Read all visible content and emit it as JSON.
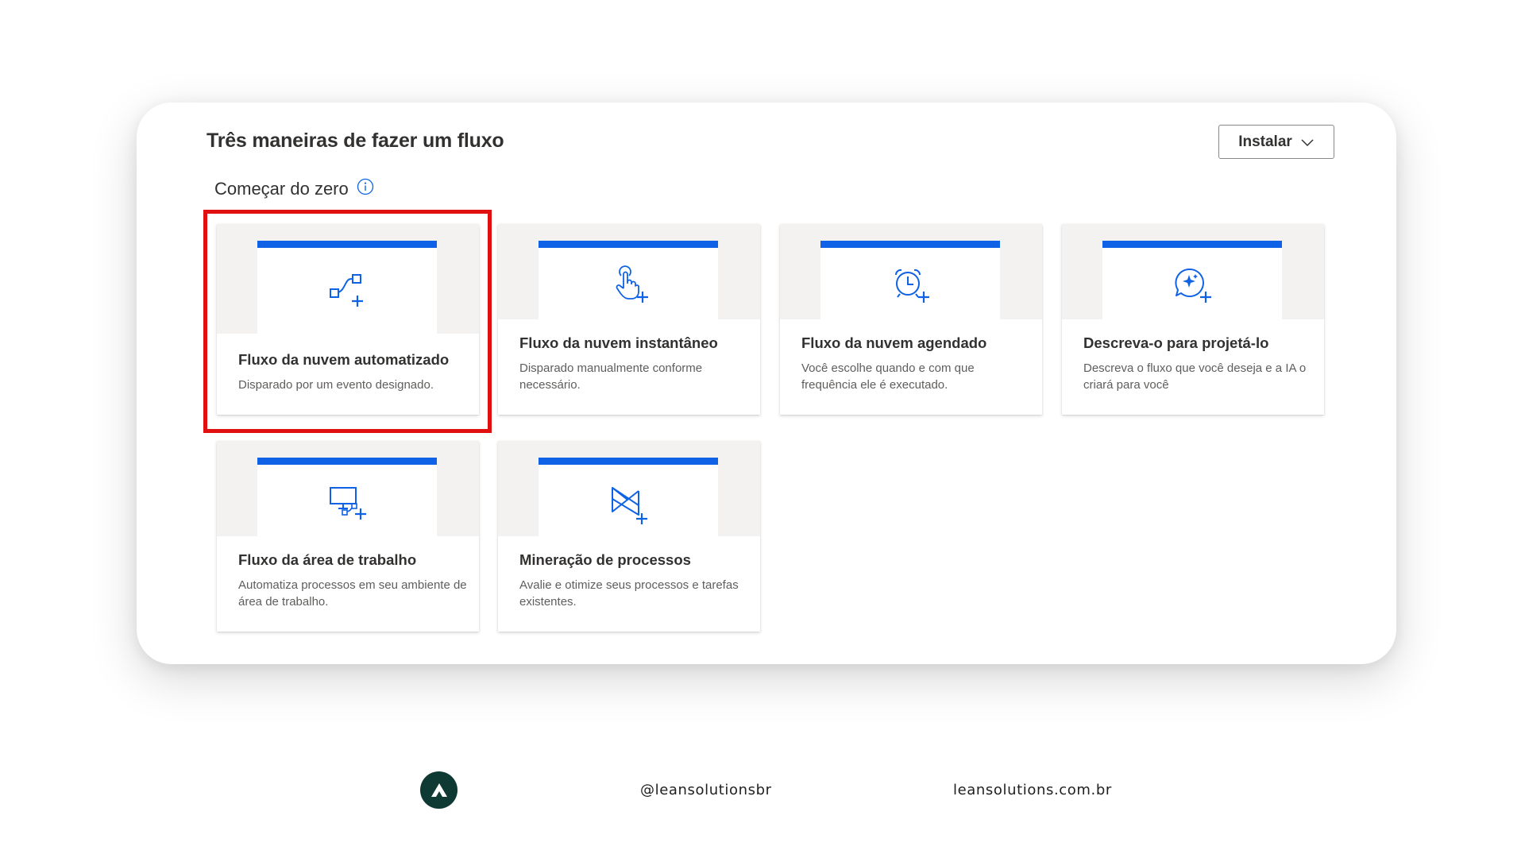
{
  "header": {
    "title": "Três maneiras de fazer um fluxo",
    "install_label": "Instalar"
  },
  "section": {
    "heading": "Começar do zero"
  },
  "tiles": [
    {
      "title": "Fluxo da nuvem automatizado",
      "description": "Disparado por um evento designado.",
      "icon": "automated-flow-icon"
    },
    {
      "title": "Fluxo da nuvem instantâneo",
      "description": "Disparado manualmente conforme necessário.",
      "icon": "touch-hand-icon"
    },
    {
      "title": "Fluxo da nuvem agendado",
      "description": "Você escolhe quando e com que frequência ele é executado.",
      "icon": "alarm-clock-icon"
    },
    {
      "title": "Descreva-o para projetá-lo",
      "description": "Descreva o fluxo que você deseja e a IA o criará para você",
      "icon": "sparkle-chat-icon"
    },
    {
      "title": "Fluxo da área de trabalho",
      "description": "Automatiza processos em seu ambiente de área de trabalho.",
      "icon": "desktop-flow-icon"
    },
    {
      "title": "Mineração de processos",
      "description": "Avalie e otimize seus processos e tarefas existentes.",
      "icon": "process-mining-icon"
    }
  ],
  "colors": {
    "accent": "#0f62e6",
    "highlight": "#e01010",
    "footer_logo": "#0e3a33"
  },
  "footer": {
    "handle": "@leansolutionsbr",
    "website": "leansolutions.com.br"
  }
}
